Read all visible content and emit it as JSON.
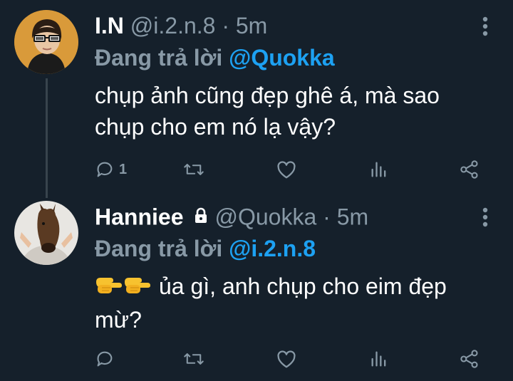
{
  "tweets": [
    {
      "name": "I.N",
      "handle": "@i.2.n.8",
      "time": "· 5m",
      "replying_label": "Đang trả lời",
      "replying_to": "@Quokka",
      "text_line1": "chụp ảnh cũng đẹp ghê á, mà sao",
      "text_line2": "chụp cho em nó lạ vậy?",
      "reply_count": "1",
      "locked": false
    },
    {
      "name": "Hanniee",
      "handle": "@Quokka",
      "time": "· 5m",
      "replying_label": "Đang trả lời",
      "replying_to": "@i.2.n.8",
      "text_line1": "ủa gì, anh chụp cho eim đẹp",
      "text_line2": "mừ?",
      "reply_count": "",
      "locked": true
    }
  ],
  "icons": {
    "reply": "reply-icon",
    "retweet": "retweet-icon",
    "like": "heart-icon",
    "analytics": "analytics-icon",
    "share": "share-icon",
    "more": "more-vertical-icon",
    "lock": "lock-icon",
    "emoji": "backhand-index-pointing-right-emoji"
  },
  "colors": {
    "background": "#15202b",
    "muted": "#8899a6",
    "accent": "#1da1f2",
    "text": "#ffffff"
  }
}
